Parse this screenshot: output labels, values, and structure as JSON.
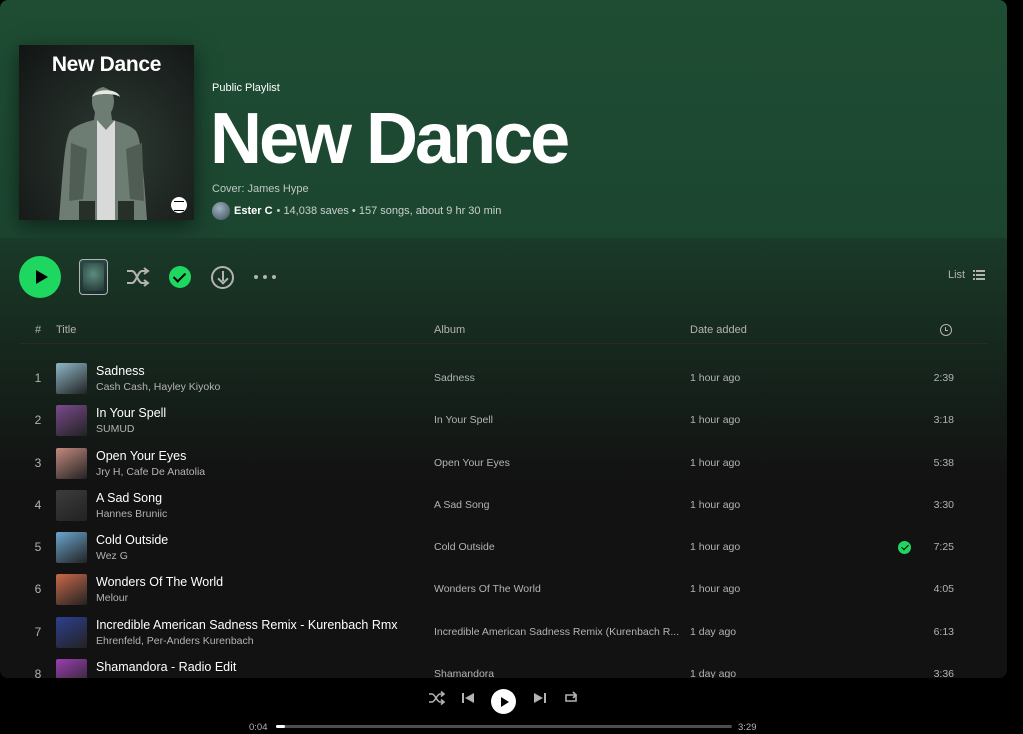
{
  "playlist": {
    "cover_title": "New Dance",
    "type_label": "Public Playlist",
    "title": "New Dance",
    "description": "Cover: James Hype",
    "owner": "Ester C",
    "stats": "• 14,038 saves • 157 songs, about 9 hr 30 min"
  },
  "actions": {
    "view_label": "List"
  },
  "table": {
    "headers": {
      "num": "#",
      "title": "Title",
      "album": "Album",
      "date": "Date added"
    },
    "rows": [
      {
        "num": "1",
        "title": "Sadness",
        "artist": "Cash Cash, Hayley Kiyoko",
        "album": "Sadness",
        "date": "1 hour ago",
        "duration": "2:39",
        "saved": false,
        "thumb": "#8fb7c8"
      },
      {
        "num": "2",
        "title": "In Your Spell",
        "artist": "SUMUD",
        "album": "In Your Spell",
        "date": "1 hour ago",
        "duration": "3:18",
        "saved": false,
        "thumb": "#7a4a8c"
      },
      {
        "num": "3",
        "title": "Open Your Eyes",
        "artist": "Jry H, Cafe De Anatolia",
        "album": "Open Your Eyes",
        "date": "1 hour ago",
        "duration": "5:38",
        "saved": false,
        "thumb": "#c28a7e"
      },
      {
        "num": "4",
        "title": "A Sad Song",
        "artist": "Hannes Bruniic",
        "album": "A Sad Song",
        "date": "1 hour ago",
        "duration": "3:30",
        "saved": false,
        "thumb": "#3c3c3c"
      },
      {
        "num": "5",
        "title": "Cold Outside",
        "artist": "Wez G",
        "album": "Cold Outside",
        "date": "1 hour ago",
        "duration": "7:25",
        "saved": true,
        "thumb": "#6aa6cf"
      },
      {
        "num": "6",
        "title": "Wonders Of The World",
        "artist": "Melour",
        "album": "Wonders Of The World",
        "date": "1 hour ago",
        "duration": "4:05",
        "saved": false,
        "thumb": "#c9694a"
      },
      {
        "num": "7",
        "title": "Incredible American Sadness Remix - Kurenbach Rmx",
        "artist": "Ehrenfeld, Per-Anders Kurenbach",
        "album": "Incredible American Sadness Remix (Kurenbach R...",
        "date": "1 day ago",
        "duration": "6:13",
        "saved": false,
        "thumb": "#2e3f8f"
      },
      {
        "num": "8",
        "title": "Shamandora - Radio Edit",
        "artist": "",
        "album": "Shamandora",
        "date": "1 day ago",
        "duration": "3:36",
        "saved": false,
        "thumb": "#9b3fb0"
      }
    ]
  },
  "player": {
    "elapsed": "0:04",
    "total": "3:29",
    "progress_fraction": 0.019
  },
  "colors": {
    "accent": "#1ed760",
    "hero": "#1e4d33",
    "background": "#121212"
  }
}
